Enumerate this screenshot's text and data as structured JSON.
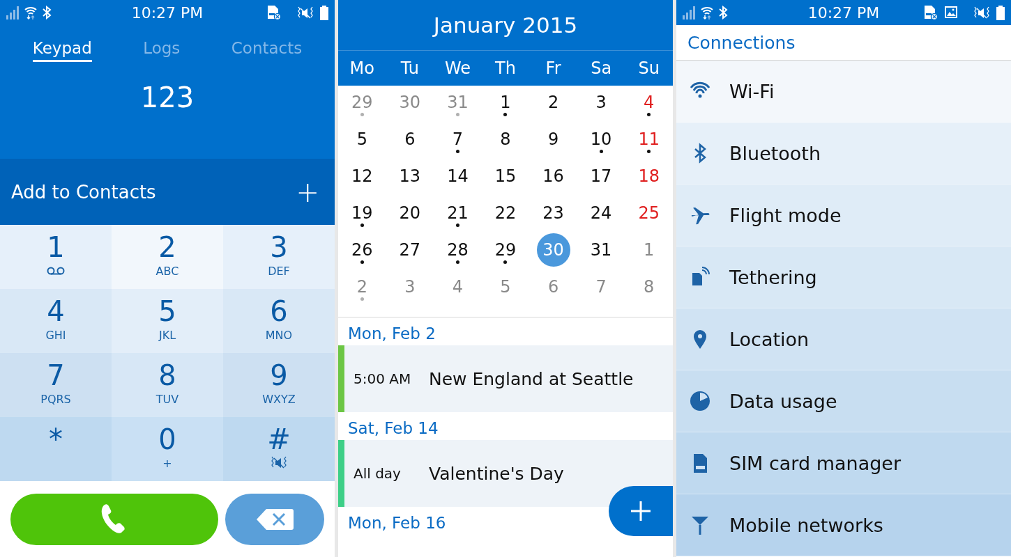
{
  "dialer": {
    "status_bar": {
      "time": "10:27 PM",
      "icons": [
        {
          "kind": "sim-missing"
        },
        {
          "kind": "mute-vibrate"
        },
        {
          "kind": "battery"
        }
      ]
    },
    "tabs": [
      {
        "label": "Keypad",
        "selected": true
      },
      {
        "label": "Logs",
        "selected": false
      },
      {
        "label": "Contacts",
        "selected": false
      }
    ],
    "number": "123",
    "add_to_contacts": {
      "label": "Add to Contacts",
      "icon": "+"
    },
    "keys": [
      {
        "digit": "1",
        "kind": "voicemail"
      },
      {
        "digit": "2",
        "sub": "ABC",
        "kind": "letters"
      },
      {
        "digit": "3",
        "sub": "DEF",
        "kind": "letters"
      },
      {
        "digit": "4",
        "sub": "GHI",
        "kind": "letters"
      },
      {
        "digit": "5",
        "sub": "JKL",
        "kind": "letters"
      },
      {
        "digit": "6",
        "sub": "MNO",
        "kind": "letters"
      },
      {
        "digit": "7",
        "sub": "PQRS",
        "kind": "letters"
      },
      {
        "digit": "8",
        "sub": "TUV",
        "kind": "letters"
      },
      {
        "digit": "9",
        "sub": "WXYZ",
        "kind": "letters"
      },
      {
        "digit": "*",
        "kind": "plain"
      },
      {
        "digit": "0",
        "sub": "+",
        "kind": "letters"
      },
      {
        "digit": "#",
        "kind": "mute"
      }
    ]
  },
  "calendar": {
    "title": "January 2015",
    "weekdays": [
      "Mo",
      "Tu",
      "We",
      "Th",
      "Fr",
      "Sa",
      "Su"
    ],
    "days": [
      {
        "d": "29",
        "muted": true,
        "sunday": false,
        "dot": true,
        "selected": false
      },
      {
        "d": "30",
        "muted": true,
        "sunday": false,
        "dot": false,
        "selected": false
      },
      {
        "d": "31",
        "muted": true,
        "sunday": false,
        "dot": true,
        "selected": false
      },
      {
        "d": "1",
        "muted": false,
        "sunday": false,
        "dot": true,
        "selected": false
      },
      {
        "d": "2",
        "muted": false,
        "sunday": false,
        "dot": false,
        "selected": false
      },
      {
        "d": "3",
        "muted": false,
        "sunday": false,
        "dot": false,
        "selected": false
      },
      {
        "d": "4",
        "muted": false,
        "sunday": true,
        "dot": true,
        "selected": false
      },
      {
        "d": "5",
        "muted": false,
        "sunday": false,
        "dot": false,
        "selected": false
      },
      {
        "d": "6",
        "muted": false,
        "sunday": false,
        "dot": false,
        "selected": false
      },
      {
        "d": "7",
        "muted": false,
        "sunday": false,
        "dot": true,
        "selected": false
      },
      {
        "d": "8",
        "muted": false,
        "sunday": false,
        "dot": false,
        "selected": false
      },
      {
        "d": "9",
        "muted": false,
        "sunday": false,
        "dot": false,
        "selected": false
      },
      {
        "d": "10",
        "muted": false,
        "sunday": false,
        "dot": true,
        "selected": false
      },
      {
        "d": "11",
        "muted": false,
        "sunday": true,
        "dot": true,
        "selected": false
      },
      {
        "d": "12",
        "muted": false,
        "sunday": false,
        "dot": false,
        "selected": false
      },
      {
        "d": "13",
        "muted": false,
        "sunday": false,
        "dot": false,
        "selected": false
      },
      {
        "d": "14",
        "muted": false,
        "sunday": false,
        "dot": false,
        "selected": false
      },
      {
        "d": "15",
        "muted": false,
        "sunday": false,
        "dot": false,
        "selected": false
      },
      {
        "d": "16",
        "muted": false,
        "sunday": false,
        "dot": false,
        "selected": false
      },
      {
        "d": "17",
        "muted": false,
        "sunday": false,
        "dot": false,
        "selected": false
      },
      {
        "d": "18",
        "muted": false,
        "sunday": true,
        "dot": false,
        "selected": false
      },
      {
        "d": "19",
        "muted": false,
        "sunday": false,
        "dot": true,
        "selected": false
      },
      {
        "d": "20",
        "muted": false,
        "sunday": false,
        "dot": false,
        "selected": false
      },
      {
        "d": "21",
        "muted": false,
        "sunday": false,
        "dot": true,
        "selected": false
      },
      {
        "d": "22",
        "muted": false,
        "sunday": false,
        "dot": false,
        "selected": false
      },
      {
        "d": "23",
        "muted": false,
        "sunday": false,
        "dot": false,
        "selected": false
      },
      {
        "d": "24",
        "muted": false,
        "sunday": false,
        "dot": false,
        "selected": false
      },
      {
        "d": "25",
        "muted": false,
        "sunday": true,
        "dot": false,
        "selected": false
      },
      {
        "d": "26",
        "muted": false,
        "sunday": false,
        "dot": true,
        "selected": false
      },
      {
        "d": "27",
        "muted": false,
        "sunday": false,
        "dot": false,
        "selected": false
      },
      {
        "d": "28",
        "muted": false,
        "sunday": false,
        "dot": true,
        "selected": false
      },
      {
        "d": "29",
        "muted": false,
        "sunday": false,
        "dot": true,
        "selected": false
      },
      {
        "d": "30",
        "muted": false,
        "sunday": false,
        "dot": false,
        "selected": true
      },
      {
        "d": "31",
        "muted": false,
        "sunday": false,
        "dot": false,
        "selected": false
      },
      {
        "d": "1",
        "muted": true,
        "sunday": false,
        "dot": false,
        "selected": false
      },
      {
        "d": "2",
        "muted": true,
        "sunday": false,
        "dot": true,
        "selected": false
      },
      {
        "d": "3",
        "muted": true,
        "sunday": false,
        "dot": false,
        "selected": false
      },
      {
        "d": "4",
        "muted": true,
        "sunday": false,
        "dot": false,
        "selected": false
      },
      {
        "d": "5",
        "muted": true,
        "sunday": false,
        "dot": false,
        "selected": false
      },
      {
        "d": "6",
        "muted": true,
        "sunday": false,
        "dot": false,
        "selected": false
      },
      {
        "d": "7",
        "muted": true,
        "sunday": false,
        "dot": false,
        "selected": false
      },
      {
        "d": "8",
        "muted": true,
        "sunday": false,
        "dot": false,
        "selected": false
      }
    ],
    "agenda": [
      {
        "date": "Mon, Feb 2",
        "event": {
          "time": "5:00 AM",
          "title": "New England at Seattle",
          "color": "#6cc644"
        }
      },
      {
        "date": "Sat, Feb 14",
        "event": {
          "time": "All day",
          "title": "Valentine's Day",
          "color": "#3dcf87"
        }
      },
      {
        "date": "Mon, Feb 16"
      }
    ]
  },
  "settings": {
    "status_bar": {
      "time": "10:27 PM",
      "icons": [
        {
          "kind": "sim-missing"
        },
        {
          "kind": "image"
        },
        {
          "kind": "mute-vibrate"
        },
        {
          "kind": "battery"
        }
      ]
    },
    "title": "Connections",
    "items": [
      {
        "label": "Wi-Fi",
        "kind": "wifi"
      },
      {
        "label": "Bluetooth",
        "kind": "bluetooth"
      },
      {
        "label": "Flight mode",
        "kind": "plane"
      },
      {
        "label": "Tethering",
        "kind": "tethering"
      },
      {
        "label": "Location",
        "kind": "location"
      },
      {
        "label": "Data usage",
        "kind": "data"
      },
      {
        "label": "SIM card manager",
        "kind": "sim"
      },
      {
        "label": "Mobile networks",
        "kind": "network"
      }
    ]
  }
}
